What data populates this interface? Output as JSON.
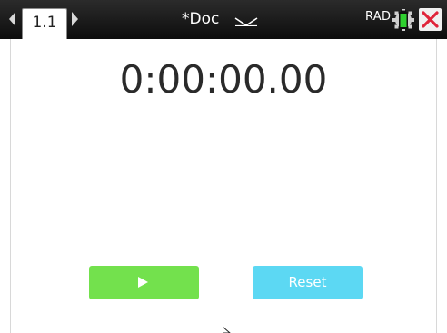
{
  "topbar": {
    "tab_label": "1.1",
    "doc_title": "*Doc",
    "angle_mode": "RAD"
  },
  "timer": {
    "display": "0:00:00.00"
  },
  "buttons": {
    "start_icon": "play-icon",
    "reset_label": "Reset"
  },
  "colors": {
    "topbar": "#111111",
    "start_button": "#73e14d",
    "reset_button": "#5cd8f3",
    "battery": "#2fd12f",
    "close_x": "#e0243a"
  }
}
